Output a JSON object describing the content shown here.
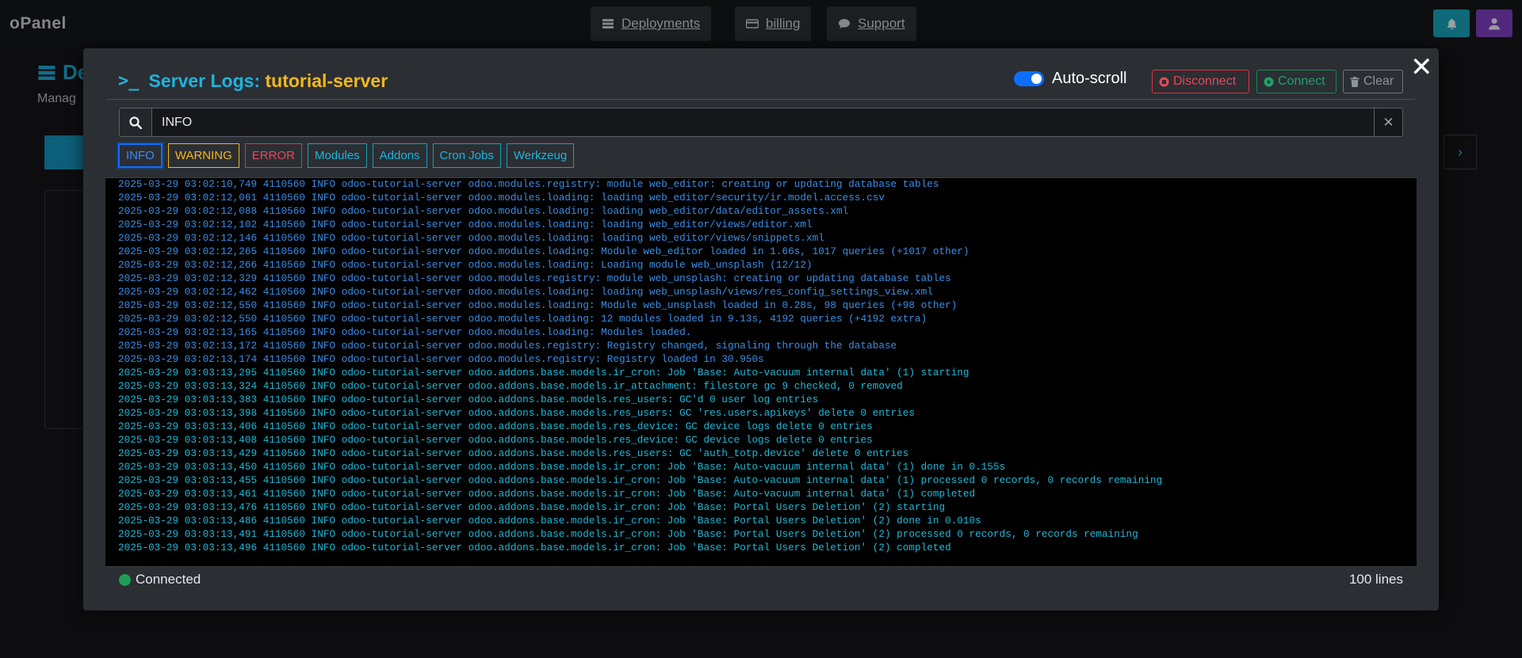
{
  "app": {
    "brand": "oPanel"
  },
  "nav": {
    "deployments": "Deployments",
    "billing": "billing",
    "support": "Support"
  },
  "background": {
    "title": "De",
    "subtitle": "Manag"
  },
  "modal": {
    "title_prefix": "Server Logs:",
    "server_name": "tutorial-server",
    "autoscroll_label": "Auto-scroll",
    "autoscroll_on": true,
    "buttons": {
      "disconnect": "Disconnect",
      "connect": "Connect",
      "clear": "Clear"
    },
    "search": {
      "value": "INFO"
    },
    "filters": [
      "INFO",
      "WARNING",
      "ERROR",
      "Modules",
      "Addons",
      "Cron Jobs",
      "Werkzeug"
    ],
    "active_filter": "INFO",
    "status": "Connected",
    "line_count": "100 lines"
  },
  "logs": [
    "2025-03-29 03:02:10,749 4110560 INFO odoo-tutorial-server odoo.modules.registry: module web_editor: creating or updating database tables",
    "2025-03-29 03:02:12,061 4110560 INFO odoo-tutorial-server odoo.modules.loading: loading web_editor/security/ir.model.access.csv",
    "2025-03-29 03:02:12,088 4110560 INFO odoo-tutorial-server odoo.modules.loading: loading web_editor/data/editor_assets.xml",
    "2025-03-29 03:02:12,102 4110560 INFO odoo-tutorial-server odoo.modules.loading: loading web_editor/views/editor.xml",
    "2025-03-29 03:02:12,146 4110560 INFO odoo-tutorial-server odoo.modules.loading: loading web_editor/views/snippets.xml",
    "2025-03-29 03:02:12,265 4110560 INFO odoo-tutorial-server odoo.modules.loading: Module web_editor loaded in 1.66s, 1017 queries (+1017 other)",
    "2025-03-29 03:02:12,266 4110560 INFO odoo-tutorial-server odoo.modules.loading: Loading module web_unsplash (12/12)",
    "2025-03-29 03:02:12,329 4110560 INFO odoo-tutorial-server odoo.modules.registry: module web_unsplash: creating or updating database tables",
    "2025-03-29 03:02:12,462 4110560 INFO odoo-tutorial-server odoo.modules.loading: loading web_unsplash/views/res_config_settings_view.xml",
    "2025-03-29 03:02:12,550 4110560 INFO odoo-tutorial-server odoo.modules.loading: Module web_unsplash loaded in 0.28s, 98 queries (+98 other)",
    "2025-03-29 03:02:12,550 4110560 INFO odoo-tutorial-server odoo.modules.loading: 12 modules loaded in 9.13s, 4192 queries (+4192 extra)",
    "2025-03-29 03:02:13,165 4110560 INFO odoo-tutorial-server odoo.modules.loading: Modules loaded.",
    "2025-03-29 03:02:13,172 4110560 INFO odoo-tutorial-server odoo.modules.registry: Registry changed, signaling through the database",
    "2025-03-29 03:02:13,174 4110560 INFO odoo-tutorial-server odoo.modules.registry: Registry loaded in 30.950s",
    "2025-03-29 03:03:13,295 4110560 INFO odoo-tutorial-server odoo.addons.base.models.ir_cron: Job 'Base: Auto-vacuum internal data' (1) starting",
    "2025-03-29 03:03:13,324 4110560 INFO odoo-tutorial-server odoo.addons.base.models.ir_attachment: filestore gc 9 checked, 0 removed",
    "2025-03-29 03:03:13,383 4110560 INFO odoo-tutorial-server odoo.addons.base.models.res_users: GC'd 0 user log entries",
    "2025-03-29 03:03:13,398 4110560 INFO odoo-tutorial-server odoo.addons.base.models.res_users: GC 'res.users.apikeys' delete 0 entries",
    "2025-03-29 03:03:13,406 4110560 INFO odoo-tutorial-server odoo.addons.base.models.res_device: GC device logs delete 0 entries",
    "2025-03-29 03:03:13,408 4110560 INFO odoo-tutorial-server odoo.addons.base.models.res_device: GC device logs delete 0 entries",
    "2025-03-29 03:03:13,429 4110560 INFO odoo-tutorial-server odoo.addons.base.models.res_users: GC 'auth_totp.device' delete 0 entries",
    "2025-03-29 03:03:13,450 4110560 INFO odoo-tutorial-server odoo.addons.base.models.ir_cron: Job 'Base: Auto-vacuum internal data' (1) done in 0.155s",
    "2025-03-29 03:03:13,455 4110560 INFO odoo-tutorial-server odoo.addons.base.models.ir_cron: Job 'Base: Auto-vacuum internal data' (1) processed 0 records, 0 records remaining",
    "2025-03-29 03:03:13,461 4110560 INFO odoo-tutorial-server odoo.addons.base.models.ir_cron: Job 'Base: Auto-vacuum internal data' (1) completed",
    "2025-03-29 03:03:13,476 4110560 INFO odoo-tutorial-server odoo.addons.base.models.ir_cron: Job 'Base: Portal Users Deletion' (2) starting",
    "2025-03-29 03:03:13,486 4110560 INFO odoo-tutorial-server odoo.addons.base.models.ir_cron: Job 'Base: Portal Users Deletion' (2) done in 0.010s",
    "2025-03-29 03:03:13,491 4110560 INFO odoo-tutorial-server odoo.addons.base.models.ir_cron: Job 'Base: Portal Users Deletion' (2) processed 0 records, 0 records remaining",
    "2025-03-29 03:03:13,496 4110560 INFO odoo-tutorial-server odoo.addons.base.models.ir_cron: Job 'Base: Portal Users Deletion' (2) completed"
  ],
  "colors": {
    "accent": "#1eb4dc",
    "server_name": "#f2b81d",
    "log_core": "#3b8de6",
    "log_addons": "#1fb8d8",
    "connected": "#1f9d55"
  }
}
